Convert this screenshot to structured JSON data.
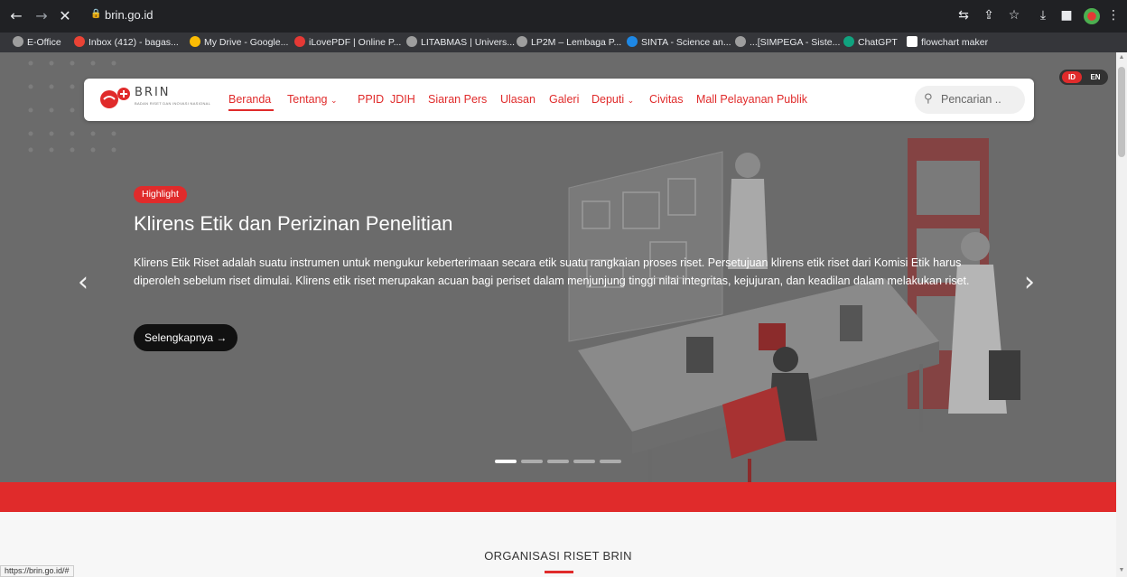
{
  "browser": {
    "url": "brin.go.id",
    "status_url": "https://brin.go.id/#",
    "bookmarks": [
      {
        "label": "E-Office",
        "color": "#9e9e9e"
      },
      {
        "label": "Inbox (412) - bagas...",
        "color": "#ea4335"
      },
      {
        "label": "My Drive - Google...",
        "color": "#fbbc04"
      },
      {
        "label": "iLovePDF | Online P...",
        "color": "#e53935"
      },
      {
        "label": "LITABMAS | Univers...",
        "color": "#9e9e9e"
      },
      {
        "label": "LP2M – Lembaga P...",
        "color": "#9e9e9e"
      },
      {
        "label": "SINTA - Science an...",
        "color": "#1e88e5"
      },
      {
        "label": "...[SIMPEGA - Siste...",
        "color": "#9e9e9e"
      },
      {
        "label": "ChatGPT",
        "color": "#10a37f"
      },
      {
        "label": "flowchart maker",
        "color": "#ffffff"
      }
    ]
  },
  "header": {
    "logo_word": "BRIN",
    "logo_sub": "BADAN RISET DAN INOVASI NASIONAL",
    "menu": [
      "Beranda",
      "Tentang",
      "PPID",
      "JDIH",
      "Siaran Pers",
      "Ulasan",
      "Galeri",
      "Deputi",
      "Civitas",
      "Mall Pelayanan Publik"
    ],
    "search_placeholder": "Pencarian ..",
    "lang_id": "ID",
    "lang_en": "EN"
  },
  "hero": {
    "badge": "Highlight",
    "title": "Klirens Etik dan Perizinan Penelitian",
    "description": "Klirens Etik Riset adalah suatu instrumen untuk mengukur keberterimaan secara etik suatu rangkaian proses riset. Persetujuan klirens etik riset dari Komisi Etik harus diperoleh sebelum riset dimulai. Klirens etik riset merupakan acuan bagi periset dalam menjunjung tinggi nilai integritas, kejujuran, dan keadilan dalam melakukan riset.",
    "cta": "Selengkapnya →",
    "prev": "‹",
    "next": "›",
    "slides": 5,
    "active_slide": 1
  },
  "section": {
    "title": "ORGANISASI RISET BRIN"
  },
  "colors": {
    "brand_red": "#e02b2b",
    "overlay_gray": "#6b6b6b"
  }
}
